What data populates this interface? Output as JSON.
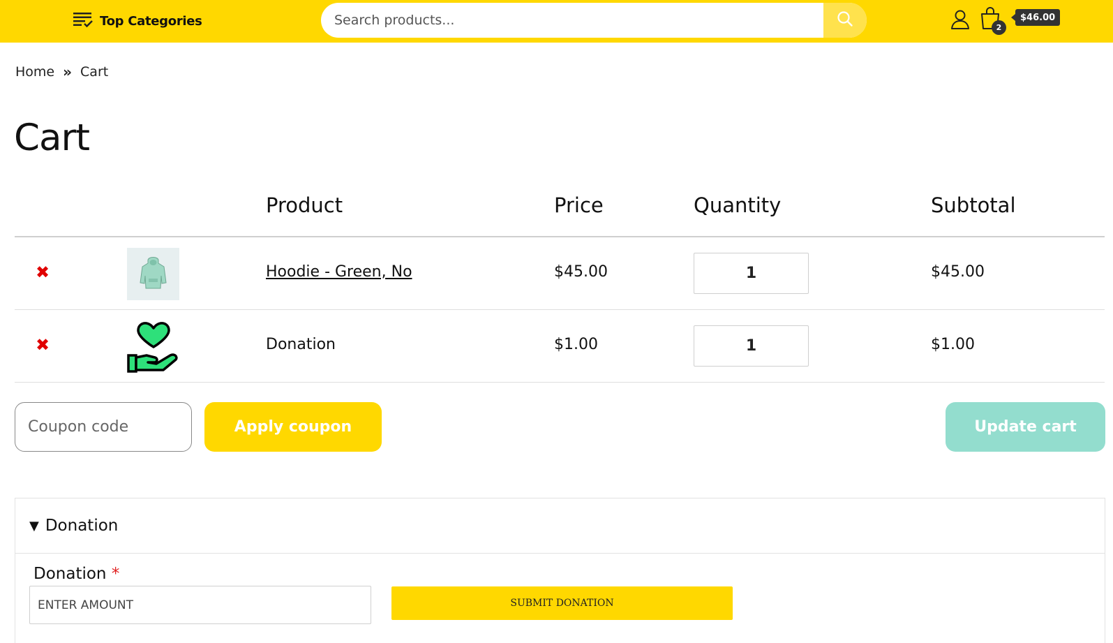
{
  "header": {
    "categories_label": "Top Categories",
    "search_placeholder": "Search products...",
    "cart_count": "2",
    "cart_total": "$46.00",
    "icons": [
      "menu-list-icon",
      "search-icon",
      "user-icon",
      "shopping-bag-icon"
    ]
  },
  "breadcrumb": {
    "home": "Home",
    "separator": "»",
    "current": "Cart"
  },
  "page_title": "Cart",
  "table": {
    "headers": {
      "product": "Product",
      "price": "Price",
      "quantity": "Quantity",
      "subtotal": "Subtotal"
    },
    "rows": [
      {
        "remove": "✖",
        "name": "Hoodie - Green, No",
        "price": "$45.00",
        "quantity": "1",
        "subtotal": "$45.00",
        "thumb": "hoodie-thumbnail"
      },
      {
        "remove": "✖",
        "name": "Donation",
        "price": "$1.00",
        "quantity": "1",
        "subtotal": "$1.00",
        "thumb": "heart-hand-icon"
      }
    ]
  },
  "actions": {
    "coupon_placeholder": "Coupon code",
    "apply_label": "Apply coupon",
    "update_label": "Update cart"
  },
  "donation": {
    "section_title": "Donation",
    "toggle_glyph": "▼",
    "field_label": "Donation",
    "required_mark": "*",
    "amount_placeholder": "ENTER AMOUNT",
    "submit_label": "SUBMIT DONATION"
  },
  "colors": {
    "accent": "#ffd800",
    "update_button": "#93ddce",
    "remove": "#e00000",
    "heart_green": "#2ee07a"
  }
}
